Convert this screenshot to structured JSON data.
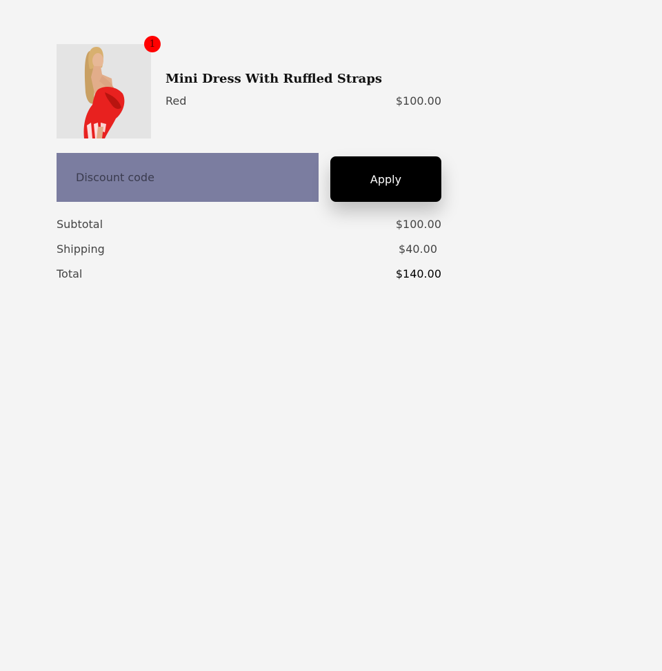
{
  "cart": {
    "item": {
      "name": "Mini Dress With Ruffled Straps",
      "variant": "Red",
      "price": "$100.00",
      "quantity_badge": "1",
      "image_icon": "product-photo"
    }
  },
  "discount": {
    "placeholder": "Discount code",
    "value": "",
    "apply_label": "Apply"
  },
  "summary": {
    "subtotal_label": "Subtotal",
    "subtotal_value": "$100.00",
    "shipping_label": "Shipping",
    "shipping_value": "$40.00",
    "total_label": "Total",
    "total_value": "$140.00"
  },
  "colors": {
    "page_background": "#f4f4f4",
    "badge": "#ff0000",
    "discount_field": "#7b7da0",
    "apply_button": "#000000",
    "product_red": "#e8211f"
  }
}
